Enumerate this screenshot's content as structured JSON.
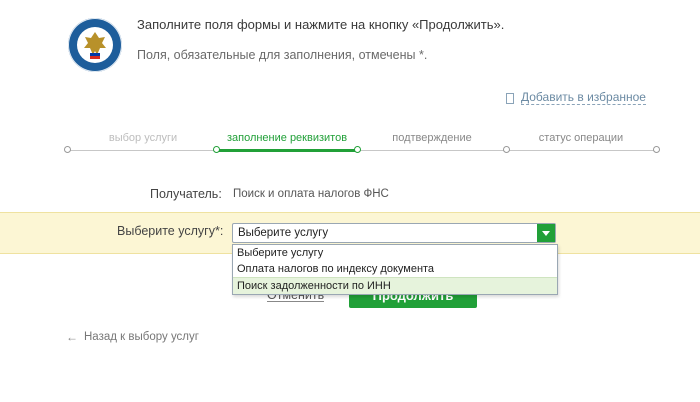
{
  "header": {
    "logo_icon": "fns-emblem-icon",
    "instruction": "Заполните поля формы и нажмите на кнопку «Продолжить».",
    "required_note": "Поля, обязательные для заполнения, отмечены *."
  },
  "favorite": {
    "icon": "bookmark-icon",
    "label": "Добавить в избранное"
  },
  "steps": [
    {
      "label": "выбор услуги",
      "state": "done"
    },
    {
      "label": "заполнение реквизитов",
      "state": "active"
    },
    {
      "label": "подтверждение",
      "state": "pending"
    },
    {
      "label": "статус операции",
      "state": "pending"
    }
  ],
  "recipient": {
    "label": "Получатель:",
    "value": "Поиск и оплата налогов ФНС"
  },
  "service": {
    "label": "Выберите услугу*:",
    "selected": "Выберите услугу",
    "options": [
      "Выберите услугу",
      "Оплата налогов по индексу документа",
      "Поиск задолженности по ИНН"
    ],
    "highlighted_option": "Поиск задолженности по ИНН"
  },
  "actions": {
    "cancel_label": "Отменить",
    "continue_label": "Продолжить"
  },
  "back_link": {
    "label": "Назад к выбору услуг"
  },
  "colors": {
    "accent": "#21a038",
    "band": "#fcf6d4",
    "muted_link": "#6b8aa3"
  }
}
